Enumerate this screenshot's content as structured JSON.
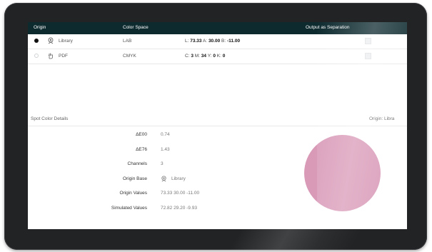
{
  "table": {
    "headers": {
      "origin": "Origin",
      "color_space": "Color Space",
      "separation": "Output as Separation"
    },
    "rows": [
      {
        "selected": true,
        "origin_icon": "library-icon",
        "origin": "Library",
        "color_space": "LAB",
        "values": [
          {
            "label": "L:",
            "value": "73.33"
          },
          {
            "label": "A:",
            "value": "30.00"
          },
          {
            "label": "B:",
            "value": "-11.00"
          }
        ],
        "separation": false
      },
      {
        "selected": false,
        "origin_icon": "hand-pointer-icon",
        "origin": "PDF",
        "color_space": "CMYK",
        "values": [
          {
            "label": "C:",
            "value": "3"
          },
          {
            "label": "M:",
            "value": "34"
          },
          {
            "label": "Y:",
            "value": "0"
          },
          {
            "label": "K:",
            "value": "0"
          }
        ],
        "separation": false
      }
    ]
  },
  "details": {
    "title": "Spot Color Details",
    "origin_label": "Origin:",
    "origin_value": "Libra",
    "fields": [
      {
        "label": "ΔE00",
        "value": "0.74"
      },
      {
        "label": "ΔE76",
        "value": "1.43"
      },
      {
        "label": "Channels",
        "value": "3"
      },
      {
        "label": "Origin Base",
        "value": "Library",
        "icon": "library-icon"
      },
      {
        "label": "Origin Values",
        "value": "73.33 30.00 -11.00"
      },
      {
        "label": "Simulated Values",
        "value": "72.82 29.20 -9.93"
      }
    ],
    "swatch_color": "#d99ab8"
  },
  "colors": {
    "header_bg": "#0d2a2f",
    "bezel": "#222325"
  }
}
